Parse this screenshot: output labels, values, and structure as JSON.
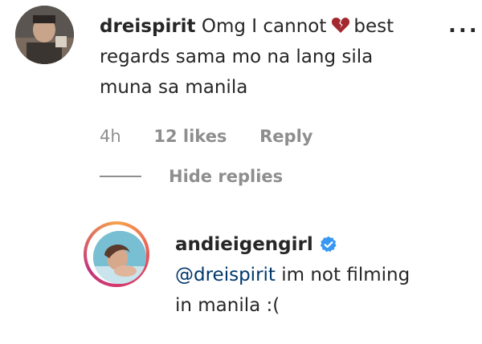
{
  "comment": {
    "username": "dreispirit",
    "text_before_icon": "Omg I cannot",
    "icon": "broken-heart-icon",
    "text_after_icon": "best",
    "line2": "regards sama mo na lang sila",
    "line3": "muna sa manila",
    "time": "4h",
    "likes": "12 likes",
    "reply_label": "Reply",
    "more_label": "..."
  },
  "replies_toggle": {
    "label": "Hide replies"
  },
  "reply": {
    "username": "andieigengirl",
    "verified_icon": "verified-badge-icon",
    "mention": "@dreispirit",
    "text_after_mention": " im not filming",
    "line2": "in manila :("
  },
  "colors": {
    "text": "#262626",
    "meta": "#8e8e8e",
    "mention": "#00376b",
    "verified": "#3897f0",
    "heart": "#a3282f"
  }
}
